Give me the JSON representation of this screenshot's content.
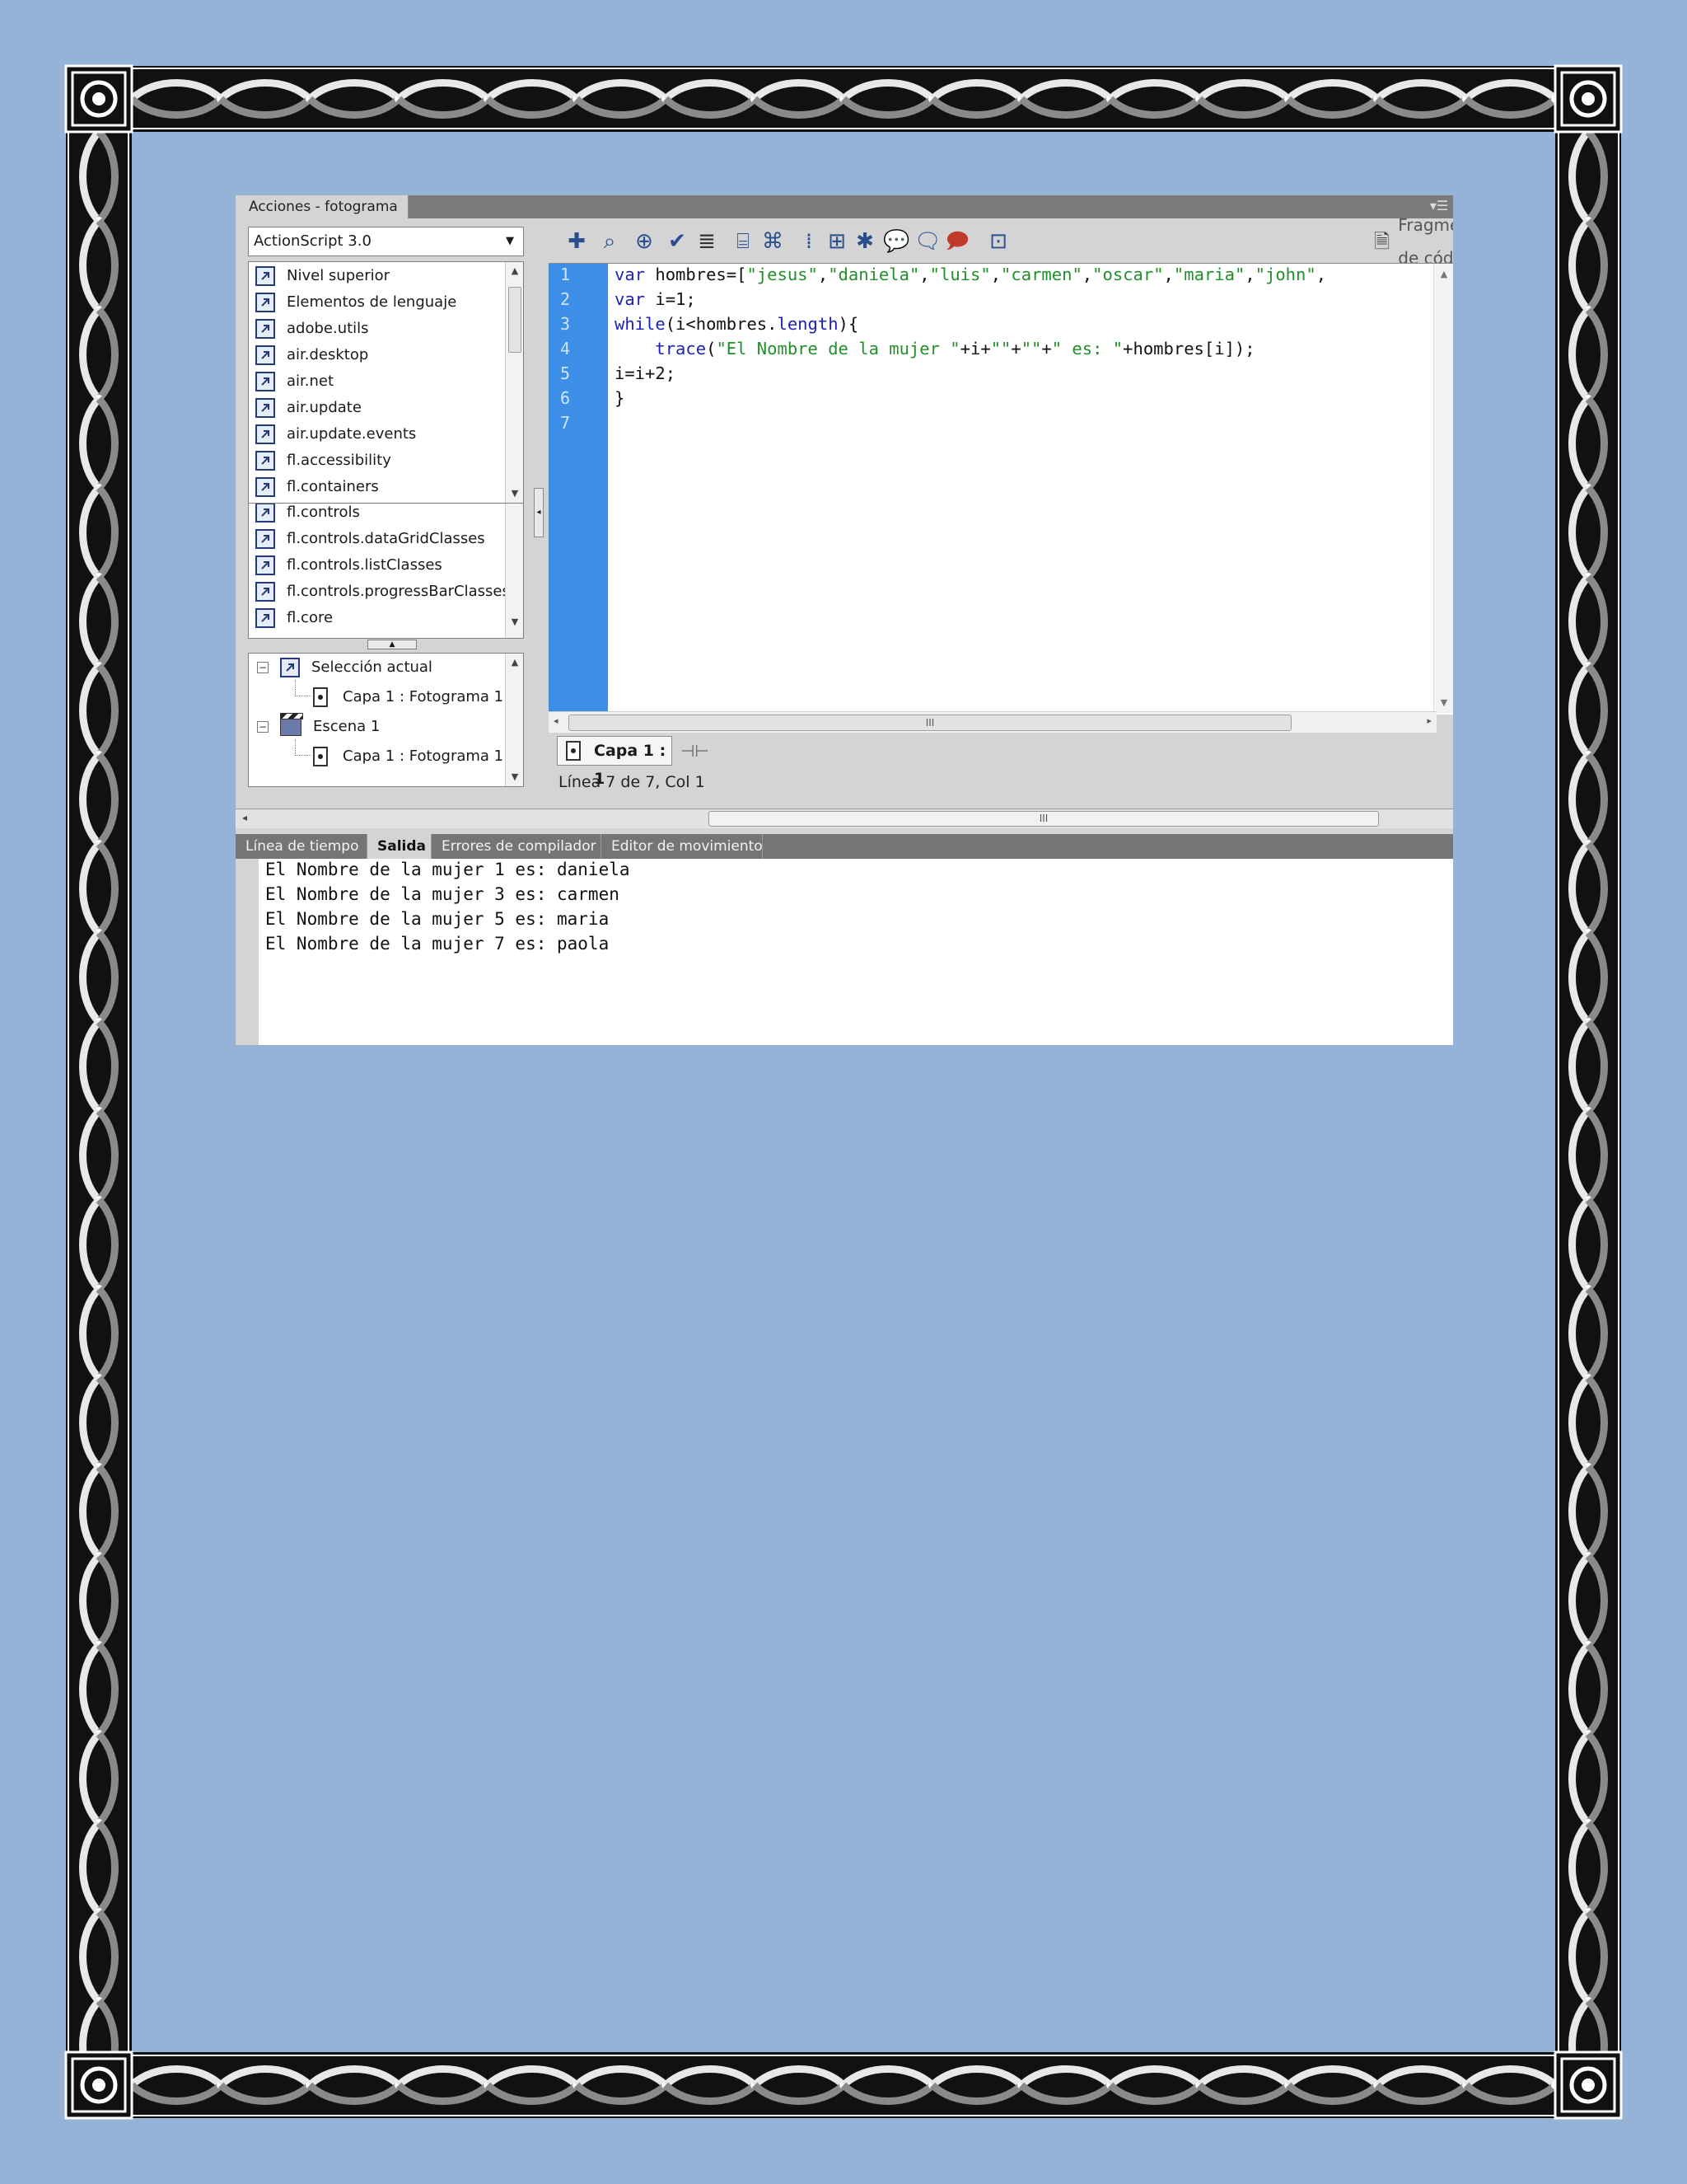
{
  "panel": {
    "title": "Acciones - fotograma",
    "menu_icon": "panel-menu-icon"
  },
  "left": {
    "language_select": "ActionScript 3.0",
    "toolbox_items": [
      "Nivel superior",
      "Elementos de lenguaje",
      "adobe.utils",
      "air.desktop",
      "air.net",
      "air.update",
      "air.update.events",
      "fl.accessibility",
      "fl.containers",
      "fl.controls",
      "fl.controls.dataGridClasses",
      "fl.controls.listClasses",
      "fl.controls.progressBarClasses",
      "fl.core"
    ],
    "tree": {
      "current_selection": "Selección actual",
      "current_frame": "Capa 1 : Fotograma 1",
      "scene": "Escena 1",
      "scene_frame": "Capa 1 : Fotograma 1"
    }
  },
  "toolbar": {
    "icons": [
      "add-statement-icon",
      "find-icon",
      "target-icon",
      "check-syntax-icon",
      "auto-format-icon",
      "code-hint-icon",
      "debug-icon",
      "collapse-between-braces-icon",
      "collapse-selection-icon",
      "expand-all-icon",
      "apply-block-comment-icon",
      "apply-line-comment-icon",
      "remove-comment-icon",
      "show-hide-toolbox-icon"
    ],
    "snippets_label": "Fragmentos de código",
    "wizard_icon": "script-assist-icon",
    "help_icon": "help-icon"
  },
  "editor": {
    "line_numbers": [
      "1",
      "2",
      "3",
      "4",
      "5",
      "6",
      "7"
    ],
    "code": [
      "var hombres=[\"jesus\",\"daniela\",\"luis\",\"carmen\",\"oscar\",\"maria\",\"john\",",
      "var i=1;",
      "while(i<hombres.length){",
      "    trace(\"El Nombre de la mujer \"+i+\"\"+\"\"+\" es: \"+hombres[i]);",
      "i=i+2;",
      "}",
      ""
    ],
    "script_tab": "Capa 1 : 1",
    "status": "Línea 7 de 7, Col 1",
    "hscroll_grip": "III"
  },
  "bottom": {
    "tabs": [
      "Línea de tiempo",
      "Salida",
      "Errores de compilador",
      "Editor de movimiento"
    ],
    "active_tab": "Salida",
    "output": [
      "El Nombre de la mujer 1 es: daniela",
      "El Nombre de la mujer 3 es: carmen",
      "El Nombre de la mujer 5 es: maria",
      "El Nombre de la mujer 7 es: paola"
    ]
  },
  "colors": {
    "background": "#95b3d7",
    "gutter": "#3d8ee7",
    "keyword": "#1d23b5",
    "string": "#218f2a"
  }
}
